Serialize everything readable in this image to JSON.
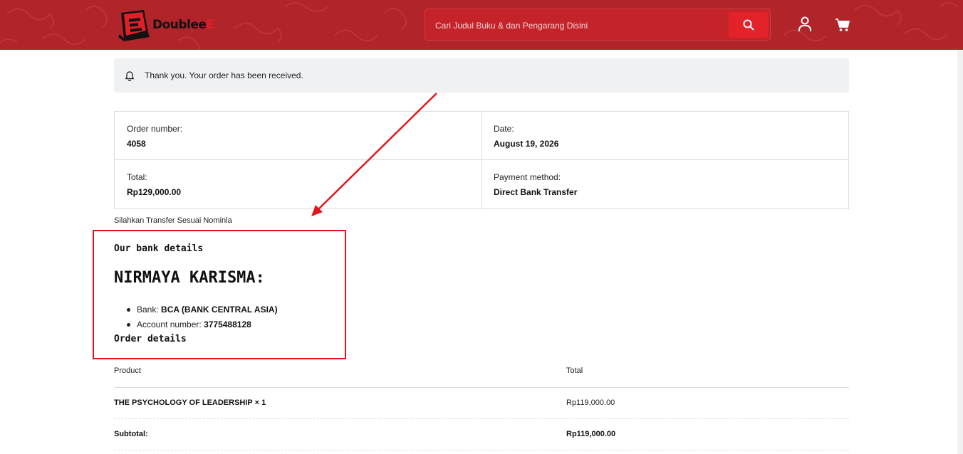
{
  "header": {
    "logo_text_main": "Doublee",
    "logo_text_accent": "E",
    "search_placeholder": "Cari Judul Buku & dan Pengarang Disini",
    "icons": [
      "search-icon",
      "user-icon",
      "cart-icon"
    ],
    "colors": {
      "brand_red": "#b0242a",
      "button_red": "#e3222a"
    }
  },
  "notice": {
    "text": "Thank you. Your order has been received.",
    "icon": "bell-icon"
  },
  "overview": {
    "order_number_label": "Order number:",
    "order_number": "4058",
    "date_label": "Date:",
    "date": "August 19, 2026",
    "total_label": "Total:",
    "total": "Rp129,000.00",
    "payment_label": "Payment method:",
    "payment": "Direct Bank Transfer"
  },
  "instruction": "Silahkan Transfer Sesuai Nominla",
  "bank": {
    "heading": "Our bank details",
    "account_name": "NIRMAYA KARISMA:",
    "bank_label": "Bank:",
    "bank_value": "BCA (BANK CENTRAL ASIA)",
    "account_label": "Account number:",
    "account_value": "3775488128"
  },
  "order_details": {
    "heading": "Order details",
    "col_product": "Product",
    "col_total": "Total",
    "items": [
      {
        "product": "THE PSYCHOLOGY OF LEADERSHIP",
        "qty": "× 1",
        "total": "Rp119,000.00"
      }
    ],
    "subtotal_label": "Subtotal:",
    "subtotal": "Rp119,000.00"
  },
  "annotation": {
    "color": "#e3151c"
  }
}
